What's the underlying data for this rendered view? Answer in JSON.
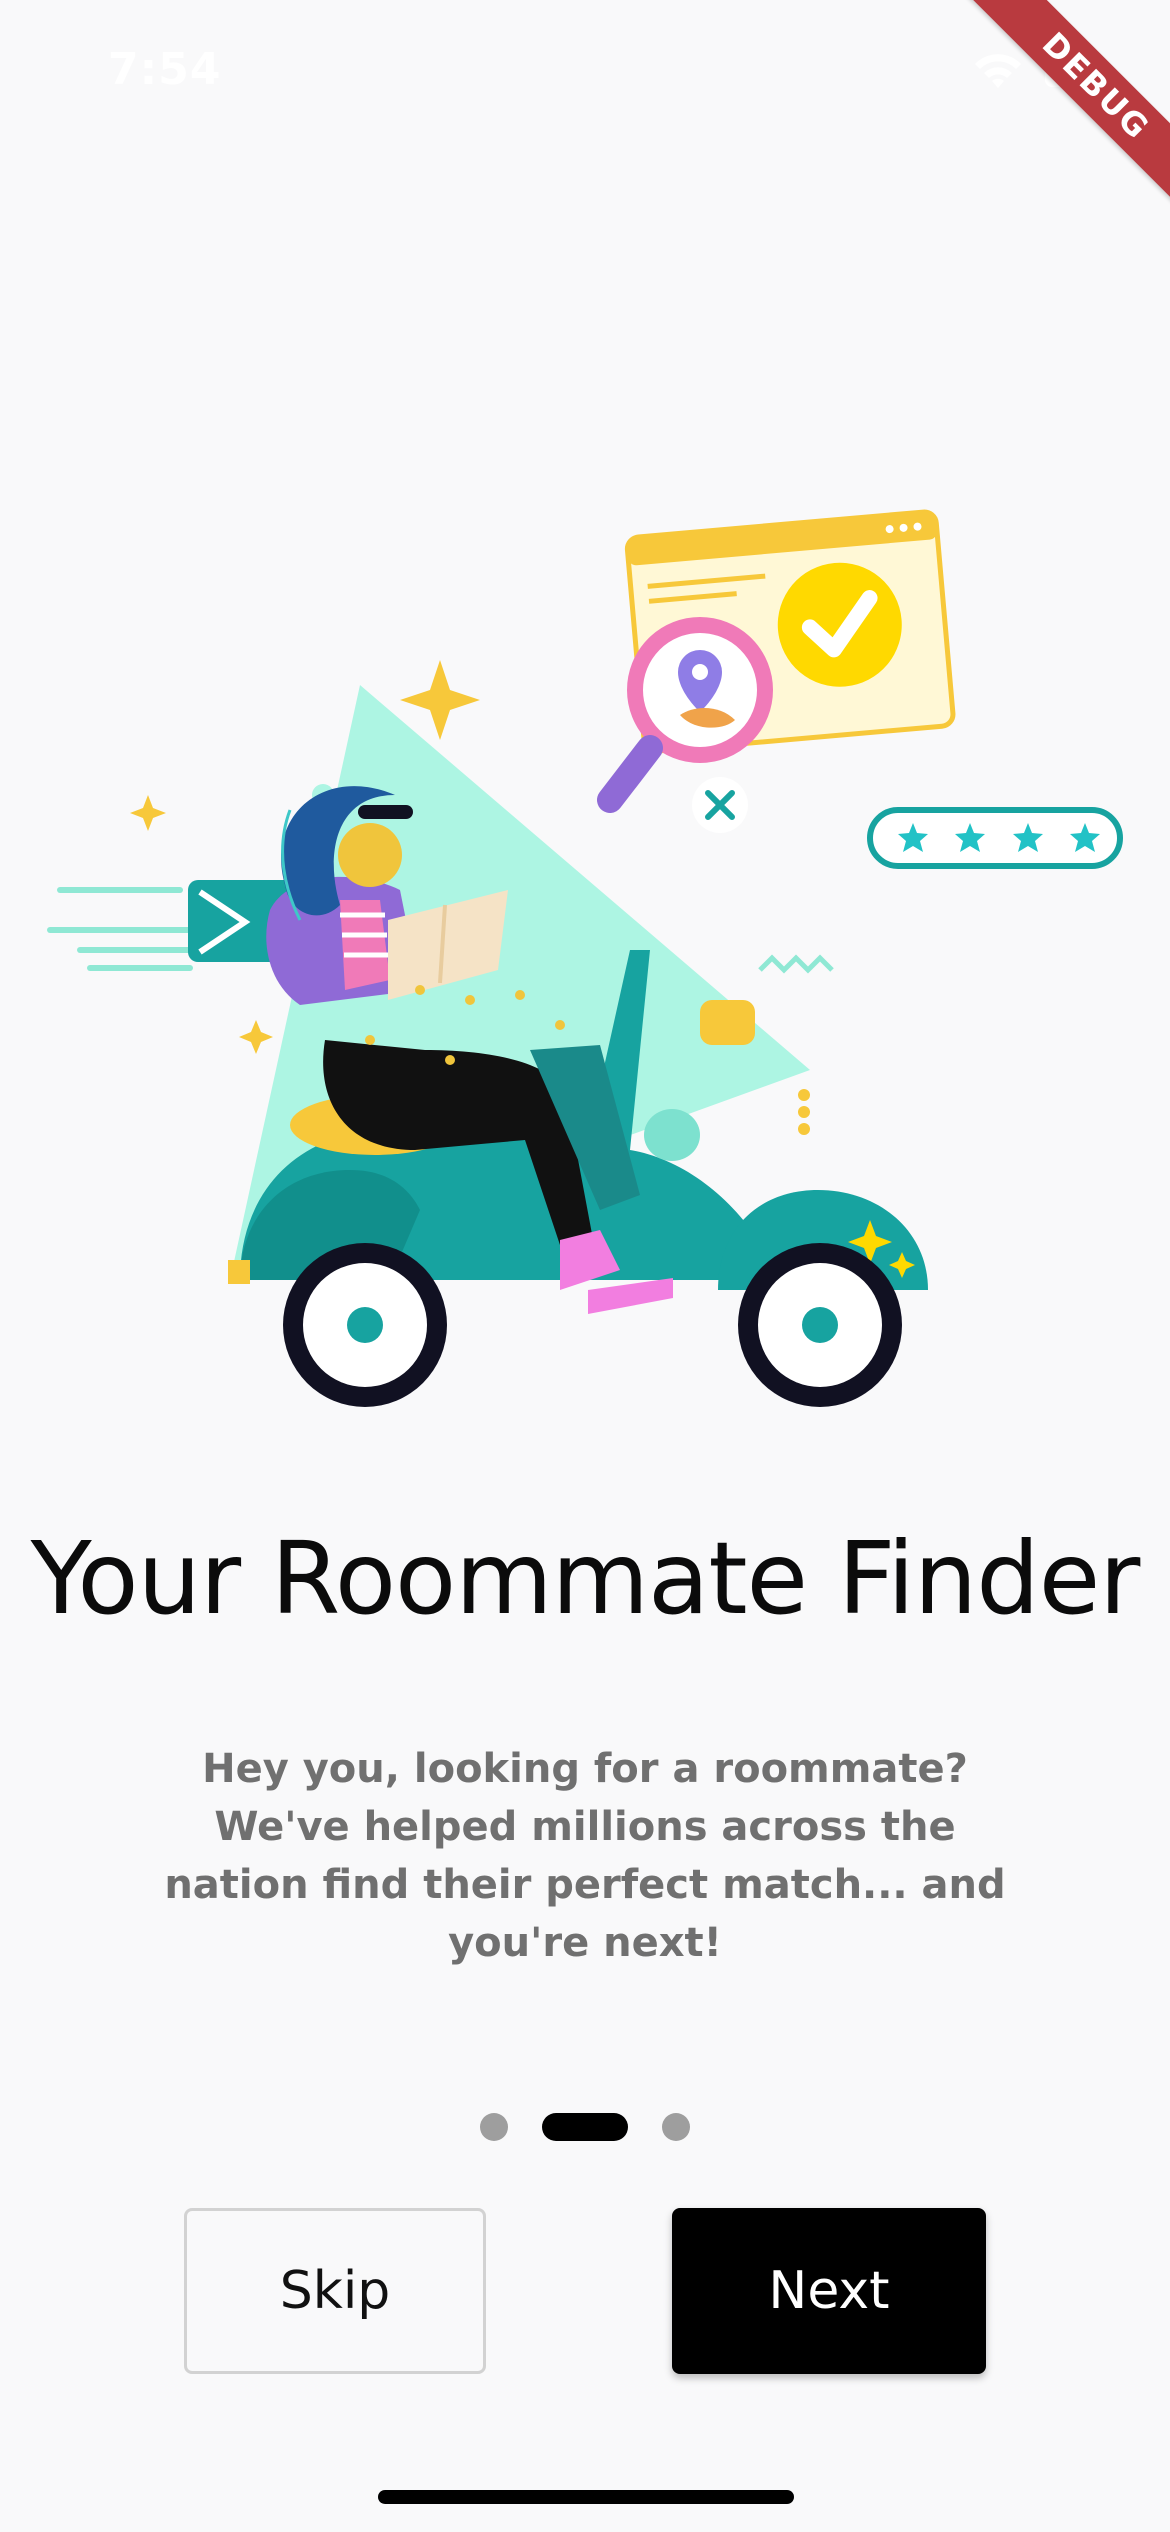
{
  "status_bar": {
    "time": "7:54"
  },
  "debug_banner": {
    "label": "DEBUG"
  },
  "onboarding": {
    "title": "Your Roommate Finder",
    "subtitle": "Hey you, looking for a roommate? We've helped millions across the nation find their perfect match... and you're next!",
    "page_indicator": {
      "total": 3,
      "active_index": 1
    },
    "skip_label": "Skip",
    "next_label": "Next"
  },
  "colors": {
    "background": "#f9f9fa",
    "primary": "#000000",
    "indicator_inactive": "#9e9e9e",
    "subtitle_text": "#707070",
    "accent_teal": "#17a3a0",
    "accent_yellow": "#f7c83a"
  }
}
